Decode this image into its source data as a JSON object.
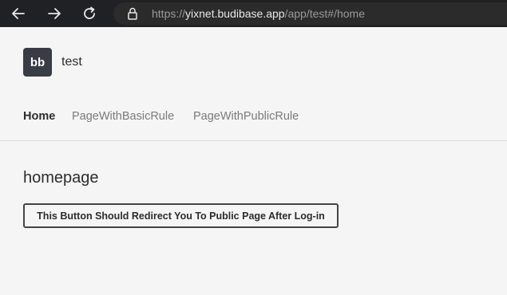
{
  "browser": {
    "url_scheme": "https://",
    "url_host": "yixnet.budibase.app",
    "url_path": "/app/test#/home",
    "icons": {
      "back": "arrow-left-icon",
      "forward": "arrow-right-icon",
      "reload": "reload-icon",
      "lock": "lock-icon"
    }
  },
  "app": {
    "logo_text": "bb",
    "title": "test",
    "nav": [
      {
        "label": "Home",
        "active": true
      },
      {
        "label": "PageWithBasicRule",
        "active": false
      },
      {
        "label": "PageWithPublicRule",
        "active": false
      }
    ]
  },
  "main": {
    "heading": "homepage",
    "button_label": "This Button Should Redirect You To Public Page After Log-in"
  },
  "colors": {
    "chrome": "#202124",
    "background": "#f5f5f5",
    "logo_bg": "#393c44",
    "text": "#2c2c2c",
    "muted_text": "#7a7a7a"
  }
}
